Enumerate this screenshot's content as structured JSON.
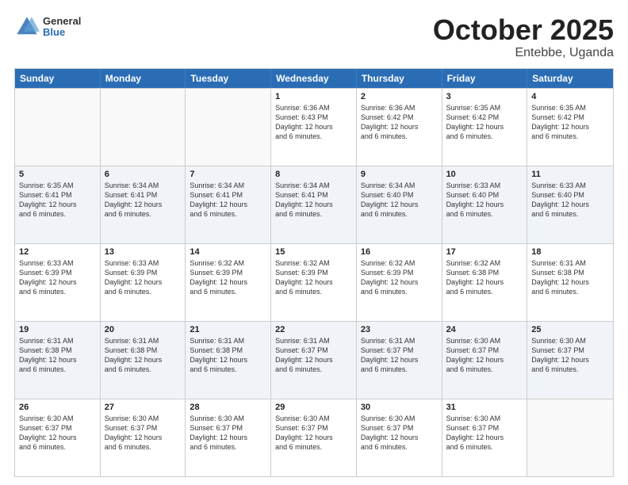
{
  "header": {
    "logo_general": "General",
    "logo_blue": "Blue",
    "title": "October 2025",
    "location": "Entebbe, Uganda"
  },
  "weekdays": [
    "Sunday",
    "Monday",
    "Tuesday",
    "Wednesday",
    "Thursday",
    "Friday",
    "Saturday"
  ],
  "rows": [
    [
      {
        "day": "",
        "info": "",
        "empty": true
      },
      {
        "day": "",
        "info": "",
        "empty": true
      },
      {
        "day": "",
        "info": "",
        "empty": true
      },
      {
        "day": "1",
        "info": "Sunrise: 6:36 AM\nSunset: 6:43 PM\nDaylight: 12 hours\nand 6 minutes."
      },
      {
        "day": "2",
        "info": "Sunrise: 6:36 AM\nSunset: 6:42 PM\nDaylight: 12 hours\nand 6 minutes."
      },
      {
        "day": "3",
        "info": "Sunrise: 6:35 AM\nSunset: 6:42 PM\nDaylight: 12 hours\nand 6 minutes."
      },
      {
        "day": "4",
        "info": "Sunrise: 6:35 AM\nSunset: 6:42 PM\nDaylight: 12 hours\nand 6 minutes."
      }
    ],
    [
      {
        "day": "5",
        "info": "Sunrise: 6:35 AM\nSunset: 6:41 PM\nDaylight: 12 hours\nand 6 minutes."
      },
      {
        "day": "6",
        "info": "Sunrise: 6:34 AM\nSunset: 6:41 PM\nDaylight: 12 hours\nand 6 minutes."
      },
      {
        "day": "7",
        "info": "Sunrise: 6:34 AM\nSunset: 6:41 PM\nDaylight: 12 hours\nand 6 minutes."
      },
      {
        "day": "8",
        "info": "Sunrise: 6:34 AM\nSunset: 6:41 PM\nDaylight: 12 hours\nand 6 minutes."
      },
      {
        "day": "9",
        "info": "Sunrise: 6:34 AM\nSunset: 6:40 PM\nDaylight: 12 hours\nand 6 minutes."
      },
      {
        "day": "10",
        "info": "Sunrise: 6:33 AM\nSunset: 6:40 PM\nDaylight: 12 hours\nand 6 minutes."
      },
      {
        "day": "11",
        "info": "Sunrise: 6:33 AM\nSunset: 6:40 PM\nDaylight: 12 hours\nand 6 minutes."
      }
    ],
    [
      {
        "day": "12",
        "info": "Sunrise: 6:33 AM\nSunset: 6:39 PM\nDaylight: 12 hours\nand 6 minutes."
      },
      {
        "day": "13",
        "info": "Sunrise: 6:33 AM\nSunset: 6:39 PM\nDaylight: 12 hours\nand 6 minutes."
      },
      {
        "day": "14",
        "info": "Sunrise: 6:32 AM\nSunset: 6:39 PM\nDaylight: 12 hours\nand 6 minutes."
      },
      {
        "day": "15",
        "info": "Sunrise: 6:32 AM\nSunset: 6:39 PM\nDaylight: 12 hours\nand 6 minutes."
      },
      {
        "day": "16",
        "info": "Sunrise: 6:32 AM\nSunset: 6:39 PM\nDaylight: 12 hours\nand 6 minutes."
      },
      {
        "day": "17",
        "info": "Sunrise: 6:32 AM\nSunset: 6:38 PM\nDaylight: 12 hours\nand 6 minutes."
      },
      {
        "day": "18",
        "info": "Sunrise: 6:31 AM\nSunset: 6:38 PM\nDaylight: 12 hours\nand 6 minutes."
      }
    ],
    [
      {
        "day": "19",
        "info": "Sunrise: 6:31 AM\nSunset: 6:38 PM\nDaylight: 12 hours\nand 6 minutes."
      },
      {
        "day": "20",
        "info": "Sunrise: 6:31 AM\nSunset: 6:38 PM\nDaylight: 12 hours\nand 6 minutes."
      },
      {
        "day": "21",
        "info": "Sunrise: 6:31 AM\nSunset: 6:38 PM\nDaylight: 12 hours\nand 6 minutes."
      },
      {
        "day": "22",
        "info": "Sunrise: 6:31 AM\nSunset: 6:37 PM\nDaylight: 12 hours\nand 6 minutes."
      },
      {
        "day": "23",
        "info": "Sunrise: 6:31 AM\nSunset: 6:37 PM\nDaylight: 12 hours\nand 6 minutes."
      },
      {
        "day": "24",
        "info": "Sunrise: 6:30 AM\nSunset: 6:37 PM\nDaylight: 12 hours\nand 6 minutes."
      },
      {
        "day": "25",
        "info": "Sunrise: 6:30 AM\nSunset: 6:37 PM\nDaylight: 12 hours\nand 6 minutes."
      }
    ],
    [
      {
        "day": "26",
        "info": "Sunrise: 6:30 AM\nSunset: 6:37 PM\nDaylight: 12 hours\nand 6 minutes."
      },
      {
        "day": "27",
        "info": "Sunrise: 6:30 AM\nSunset: 6:37 PM\nDaylight: 12 hours\nand 6 minutes."
      },
      {
        "day": "28",
        "info": "Sunrise: 6:30 AM\nSunset: 6:37 PM\nDaylight: 12 hours\nand 6 minutes."
      },
      {
        "day": "29",
        "info": "Sunrise: 6:30 AM\nSunset: 6:37 PM\nDaylight: 12 hours\nand 6 minutes."
      },
      {
        "day": "30",
        "info": "Sunrise: 6:30 AM\nSunset: 6:37 PM\nDaylight: 12 hours\nand 6 minutes."
      },
      {
        "day": "31",
        "info": "Sunrise: 6:30 AM\nSunset: 6:37 PM\nDaylight: 12 hours\nand 6 minutes."
      },
      {
        "day": "",
        "info": "",
        "empty": true
      }
    ]
  ]
}
